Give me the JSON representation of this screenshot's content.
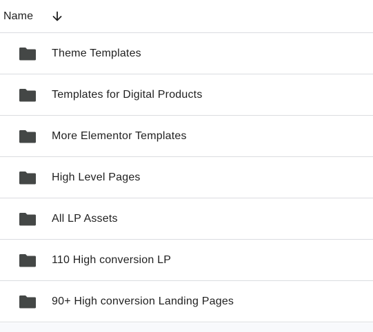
{
  "header": {
    "column_label": "Name",
    "sort_icon": "arrow-down-icon"
  },
  "folders": [
    {
      "name": "Theme Templates",
      "icon": "folder-icon"
    },
    {
      "name": "Templates for Digital Products",
      "icon": "folder-icon"
    },
    {
      "name": "More Elementor Templates",
      "icon": "folder-icon"
    },
    {
      "name": "High Level Pages",
      "icon": "folder-icon"
    },
    {
      "name": "All LP Assets",
      "icon": "folder-icon"
    },
    {
      "name": "110 High conversion LP",
      "icon": "folder-icon"
    },
    {
      "name": "90+ High conversion Landing Pages",
      "icon": "folder-icon"
    }
  ],
  "colors": {
    "text": "#1f1f1f",
    "divider": "#dadce0",
    "folder": "#444746"
  }
}
